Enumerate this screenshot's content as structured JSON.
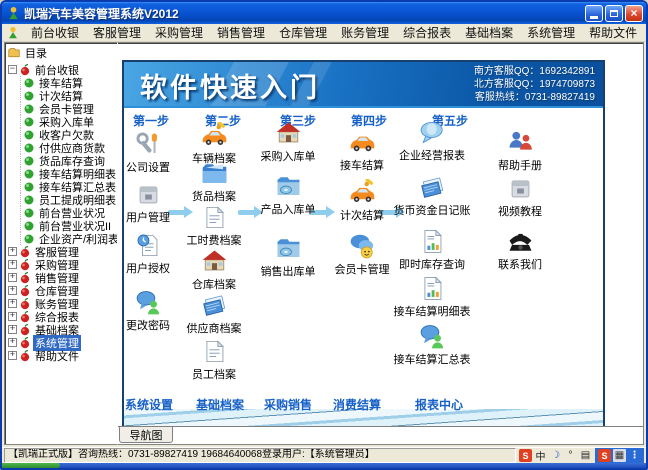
{
  "window": {
    "title": "凯瑞汽车美容管理系统V2012"
  },
  "menu": {
    "items": [
      "前台收银",
      "客服管理",
      "采购管理",
      "销售管理",
      "仓库管理",
      "账务管理",
      "综合报表",
      "基础档案",
      "系统管理",
      "帮助文件"
    ]
  },
  "sidebar": {
    "header": "目录",
    "tree": [
      {
        "label": "前台收银",
        "type": "parent",
        "expanded": true,
        "selected": false
      },
      {
        "label": "接车结算",
        "type": "child"
      },
      {
        "label": "计次结算",
        "type": "child"
      },
      {
        "label": "会员卡管理",
        "type": "child"
      },
      {
        "label": "采购入库单",
        "type": "child"
      },
      {
        "label": "收客户欠款",
        "type": "child"
      },
      {
        "label": "付供应商货款",
        "type": "child"
      },
      {
        "label": "货品库存查询",
        "type": "child"
      },
      {
        "label": "接车结算明细表",
        "type": "child"
      },
      {
        "label": "接车结算汇总表",
        "type": "child"
      },
      {
        "label": "员工提成明细表",
        "type": "child"
      },
      {
        "label": "前台营业状况",
        "type": "child"
      },
      {
        "label": "前台营业状况II",
        "type": "child"
      },
      {
        "label": "企业资产/利润表",
        "type": "child"
      },
      {
        "label": "客服管理",
        "type": "parent",
        "expanded": false,
        "selected": false
      },
      {
        "label": "采购管理",
        "type": "parent",
        "expanded": false,
        "selected": false
      },
      {
        "label": "销售管理",
        "type": "parent",
        "expanded": false,
        "selected": false
      },
      {
        "label": "仓库管理",
        "type": "parent",
        "expanded": false,
        "selected": false
      },
      {
        "label": "账务管理",
        "type": "parent",
        "expanded": false,
        "selected": false
      },
      {
        "label": "综合报表",
        "type": "parent",
        "expanded": false,
        "selected": false
      },
      {
        "label": "基础档案",
        "type": "parent",
        "expanded": false,
        "selected": false
      },
      {
        "label": "系统管理",
        "type": "parent",
        "expanded": false,
        "selected": true
      },
      {
        "label": "帮助文件",
        "type": "parent",
        "expanded": false,
        "selected": false
      }
    ]
  },
  "banner": {
    "title": "软件快速入门",
    "contacts": [
      "南方客服QQ：1692342891",
      "北方客服QQ：1974709873",
      "客服热线：0731-89827419"
    ]
  },
  "quickstart": {
    "steps": [
      "第一步",
      "第二步",
      "第三步",
      "第四步",
      "第五步"
    ],
    "columns": [
      {
        "items": [
          {
            "label": "公司设置",
            "icon": "tools-icon"
          },
          {
            "label": "用户管理",
            "icon": "box-icon"
          },
          {
            "label": "用户授权",
            "icon": "doc-clock-icon"
          },
          {
            "label": "更改密码",
            "icon": "bubble-person-icon"
          }
        ]
      },
      {
        "items": [
          {
            "label": "车辆档案",
            "icon": "car-edit-icon"
          },
          {
            "label": "货品档案",
            "icon": "folder-icon"
          },
          {
            "label": "工时费档案",
            "icon": "doc-icon"
          },
          {
            "label": "仓库档案",
            "icon": "house-icon"
          },
          {
            "label": "供应商档案",
            "icon": "pages-icon"
          },
          {
            "label": "员工档案",
            "icon": "doc-icon"
          }
        ]
      },
      {
        "items": [
          {
            "label": "采购入库单",
            "icon": "house-icon"
          },
          {
            "label": "产品入库单",
            "icon": "folder-disc-icon"
          },
          {
            "label": "销售出库单",
            "icon": "folder-disc-icon"
          }
        ]
      },
      {
        "items": [
          {
            "label": "接车结算",
            "icon": "car-icon"
          },
          {
            "label": "计次结算",
            "icon": "car-edit-icon"
          },
          {
            "label": "会员卡管理",
            "icon": "bubbles-smiley-icon"
          }
        ]
      },
      {
        "items": [
          {
            "label": "企业经营报表",
            "icon": "bubble-icon"
          },
          {
            "label": "货币资金日记账",
            "icon": "pages-icon"
          },
          {
            "label": "即时库存查询",
            "icon": "doc-chart-icon"
          },
          {
            "label": "接车结算明细表",
            "icon": "doc-chart-icon"
          },
          {
            "label": "接车结算汇总表",
            "icon": "bubble-person-icon"
          }
        ]
      },
      {
        "items": [
          {
            "label": "帮助手册",
            "icon": "people-icon"
          },
          {
            "label": "视频教程",
            "icon": "box-icon"
          },
          {
            "label": "联系我们",
            "icon": "phone-icon"
          }
        ]
      }
    ],
    "footers": [
      "系统设置",
      "基础档案",
      "采购销售",
      "消费结算",
      "报表中心"
    ]
  },
  "tabbar": {
    "tabs": [
      {
        "label": "导航图",
        "active": true
      }
    ]
  },
  "statusbar": {
    "text": "【凯瑞正式版】咨询热线：0731-89827419 19684640068登录用户:【系统管理员】",
    "tray": [
      {
        "icon": "sogou-icon",
        "glyph": "S"
      },
      {
        "icon": "lang-chinese-icon",
        "glyph": "中"
      },
      {
        "icon": "moon-icon",
        "glyph": "☽"
      },
      {
        "icon": "pen-icon",
        "glyph": "°"
      },
      {
        "icon": "keyboard-icon",
        "glyph": "▤"
      }
    ],
    "tray_active": [
      {
        "icon": "sogou-icon",
        "glyph": "S"
      },
      {
        "icon": "keyboard-icon",
        "glyph": "▦"
      },
      {
        "icon": "more-icon",
        "glyph": "⋮"
      }
    ]
  }
}
